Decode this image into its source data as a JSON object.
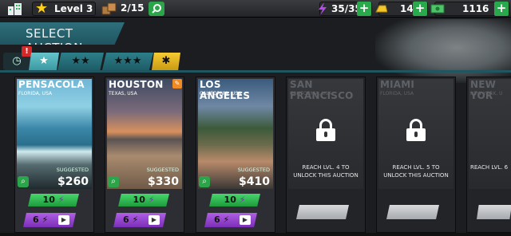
{
  "topbar": {
    "level_label": "Level 3",
    "boxes_count": "2/15",
    "energy": "35/35",
    "gold": "14",
    "cash": "1116",
    "plus": "+"
  },
  "header": {
    "title": "SELECT AUCTION",
    "alert": "!"
  },
  "filters": {
    "one_star": "★",
    "two_star": "★★",
    "three_star": "★★★",
    "gold_star": "✱"
  },
  "cards": [
    {
      "city": "PENSACOLA",
      "state": "FLORIDA, USA",
      "suggested": "SUGGESTED",
      "price": "$260",
      "green_cost": "10",
      "purple_cost": "6"
    },
    {
      "city": "HOUSTON",
      "state": "TEXAS, USA",
      "suggested": "SUGGESTED",
      "price": "$330",
      "green_cost": "10",
      "purple_cost": "6"
    },
    {
      "city": "LOS ANGELES",
      "state": "CALIFORNIA, USA",
      "suggested": "SUGGESTED",
      "price": "$410",
      "green_cost": "10",
      "purple_cost": "6"
    },
    {
      "city": "SAN FRANCISCO",
      "state": "CALIFORNIA, USA",
      "lock_text": "REACH LVL. 4 TO UNLOCK THIS AUCTION"
    },
    {
      "city": "MIAMI",
      "state": "FLORIDA, USA",
      "lock_text": "REACH LVL. 5 TO UNLOCK THIS AUCTION"
    },
    {
      "city": "NEW YOR",
      "state": "NEW YORK, U",
      "lock_text": "REACH LVL. 6"
    }
  ],
  "colors": {
    "accent_teal": "#2c7f8a",
    "green": "#2ca54a",
    "purple": "#9a48d2",
    "gold": "#f6cb33"
  }
}
